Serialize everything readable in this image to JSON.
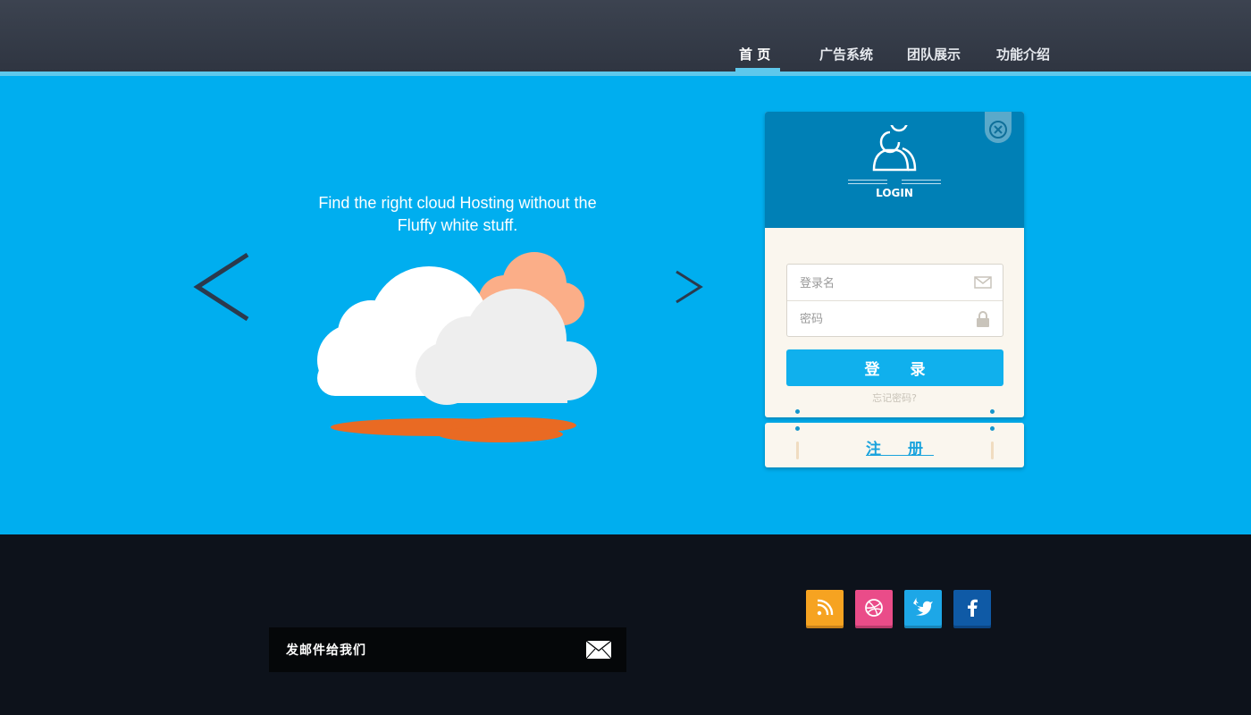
{
  "nav": {
    "items": [
      {
        "label": "首 页",
        "active": true
      },
      {
        "label": "广告系统",
        "active": false
      },
      {
        "label": "团队展示",
        "active": false
      },
      {
        "label": "功能介绍",
        "active": false
      }
    ]
  },
  "hero": {
    "tagline_line1": "Find the right cloud Hosting without the",
    "tagline_line2": "Fluffy white stuff.",
    "prev_icon": "chevron-left-icon",
    "next_icon": "chevron-right-icon"
  },
  "login": {
    "title": "LOGIN",
    "username_placeholder": "登录名",
    "password_placeholder": "密码",
    "submit_label": "登 录",
    "forgot_label": "忘记密码?",
    "register_label": "注 册"
  },
  "footer": {
    "mail_label": "发邮件给我们",
    "social": [
      {
        "name": "rss-icon",
        "color": "#f6a321"
      },
      {
        "name": "dribbble-icon",
        "color": "#ea4c89"
      },
      {
        "name": "twitter-icon",
        "color": "#1da7e7"
      },
      {
        "name": "facebook-icon",
        "color": "#0f5aa6"
      }
    ]
  },
  "colors": {
    "header": "#343a46",
    "accent": "#5ec8ec",
    "hero": "#00aeef",
    "login_header": "#0080b6",
    "footer": "#0d121b"
  }
}
